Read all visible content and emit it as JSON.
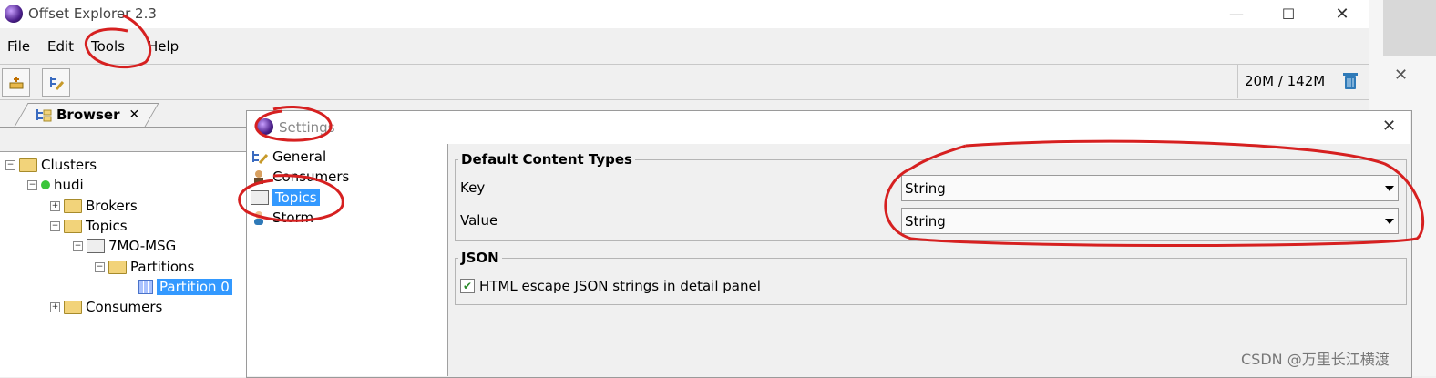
{
  "window": {
    "title": "Offset Explorer  2.3"
  },
  "menu": {
    "file": "File",
    "edit": "Edit",
    "tools": "Tools",
    "help": "Help"
  },
  "toolbar": {
    "memory": "20M / 142M"
  },
  "browser_tab": {
    "label": "Browser",
    "close": "✕"
  },
  "tree": {
    "clusters": "Clusters",
    "cluster": "hudi",
    "brokers": "Brokers",
    "topics": "Topics",
    "topic": "7MO-MSG",
    "partitions": "Partitions",
    "partition": "Partition 0",
    "consumers": "Consumers"
  },
  "settings": {
    "title": "Settings",
    "nav": [
      "General",
      "Consumers",
      "Topics",
      "Storm"
    ],
    "selected_nav": "Topics",
    "default_content_types": {
      "title": "Default Content Types",
      "key_label": "Key",
      "key_value": "String",
      "value_label": "Value",
      "value_value": "String"
    },
    "json": {
      "title": "JSON",
      "checkbox_label": "HTML escape JSON strings in detail panel",
      "checked": true
    }
  },
  "watermark": "CSDN @万里长江横渡",
  "colors": {
    "selection": "#3399ff",
    "annotation": "#d62020"
  }
}
